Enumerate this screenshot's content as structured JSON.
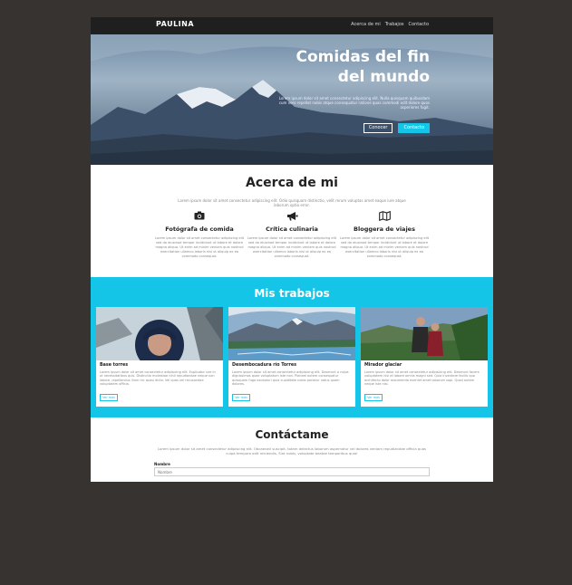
{
  "nav": {
    "brand": "PAULINA",
    "links": [
      "Acerca de mi",
      "Trabajos",
      "Contacto"
    ]
  },
  "hero": {
    "title_line1": "Comidas del fin",
    "title_line2": "del mundo",
    "text": "Lorem ipsum dolor sit amet consectetur adipiscing elit. Nulla quisquam quibusdam cum vero repellat nobis atque consequatur ratione quas commodi odit dolore quos asperiores fugit.",
    "btn_outline": "Conocer",
    "btn_solid": "Contacto"
  },
  "about": {
    "title": "Acerca de mi",
    "intro": "Lorem ipsum dolor sit amet consectetur adipiscing elit. Odio quisquam distinctio, velit rerum voluptas amet eaque iure atque laborum optio error.",
    "features": [
      {
        "icon": "camera-icon",
        "title": "Fotógrafa de comida",
        "text": "Lorem ipsum dolor sit amet consectetur adipiscing elit sed do eiusmod tempor incididunt ut labore et dolore magna aliqua. Ut enim ad minim veniam quis nostrud exercitation ullamco laboris nisi ut aliquip ex ea commodo consequat."
      },
      {
        "icon": "megaphone-icon",
        "title": "Crítica culinaria",
        "text": "Lorem ipsum dolor sit amet consectetur adipiscing elit sed do eiusmod tempor incididunt ut labore et dolore magna aliqua. Ut enim ad minim veniam quis nostrud exercitation ullamco laboris nisi ut aliquip ex ea commodo consequat."
      },
      {
        "icon": "map-icon",
        "title": "Bloggera de viajes",
        "text": "Lorem ipsum dolor sit amet consectetur adipiscing elit sed do eiusmod tempor incididunt ut labore et dolore magna aliqua. Ut enim ad minim veniam quis nostrud exercitation ullamco laboris nisi ut aliquip ex ea commodo consequat."
      }
    ]
  },
  "works": {
    "title": "Mis trabajos",
    "cards": [
      {
        "title": "Base torres",
        "text": "Lorem ipsum dolor sit amet consectetur adipisicing elit. Explicabo iure in ut necessitatibus quis. Distinctio molestiae nihil repudiandae neque non labore, repellendus illum hic quasi dicta. Vel quas vel recusandae voluptatem officia.",
        "button": "Ver más"
      },
      {
        "title": "Desembocadura río Torres",
        "text": "Lorem ipsum dolor sit amet consectetur adipisicing elit. Deserunt a culpa dignissimos quae voluptatum iste non. Placeat autem consequatur quisquam fuga excepturi quia cupiditate nobis pariatur natus quam dolores.",
        "button": "Ver más"
      },
      {
        "title": "Mirador glaciar",
        "text": "Lorem ipsum dolor sit amet consectetur adipisicing elit. Deserunt facere voluptatem nisi et labore omnis magni sed. Quia inventore facilis quo architecto dolor assumenda eveniet amet laborum sapi. Quod autem neque iste nisi.",
        "button": "Ver más"
      }
    ]
  },
  "contact": {
    "title": "Contáctame",
    "intro": "Lorem ipsum dolor sit amet consectetur adipiscing elit. Obcaecati suscipit, totam delectus laborum aspernatur vel dolores veniam repudiandae officia quas culpa tempora odit reiciendis. Sint nobis, voluptate beatae temporibus quia!",
    "name_label": "Nombre",
    "name_placeholder": "Nombre"
  },
  "colors": {
    "accent": "#15c5e8",
    "nav_bg": "#1f1f1f",
    "backdrop": "#363331"
  }
}
